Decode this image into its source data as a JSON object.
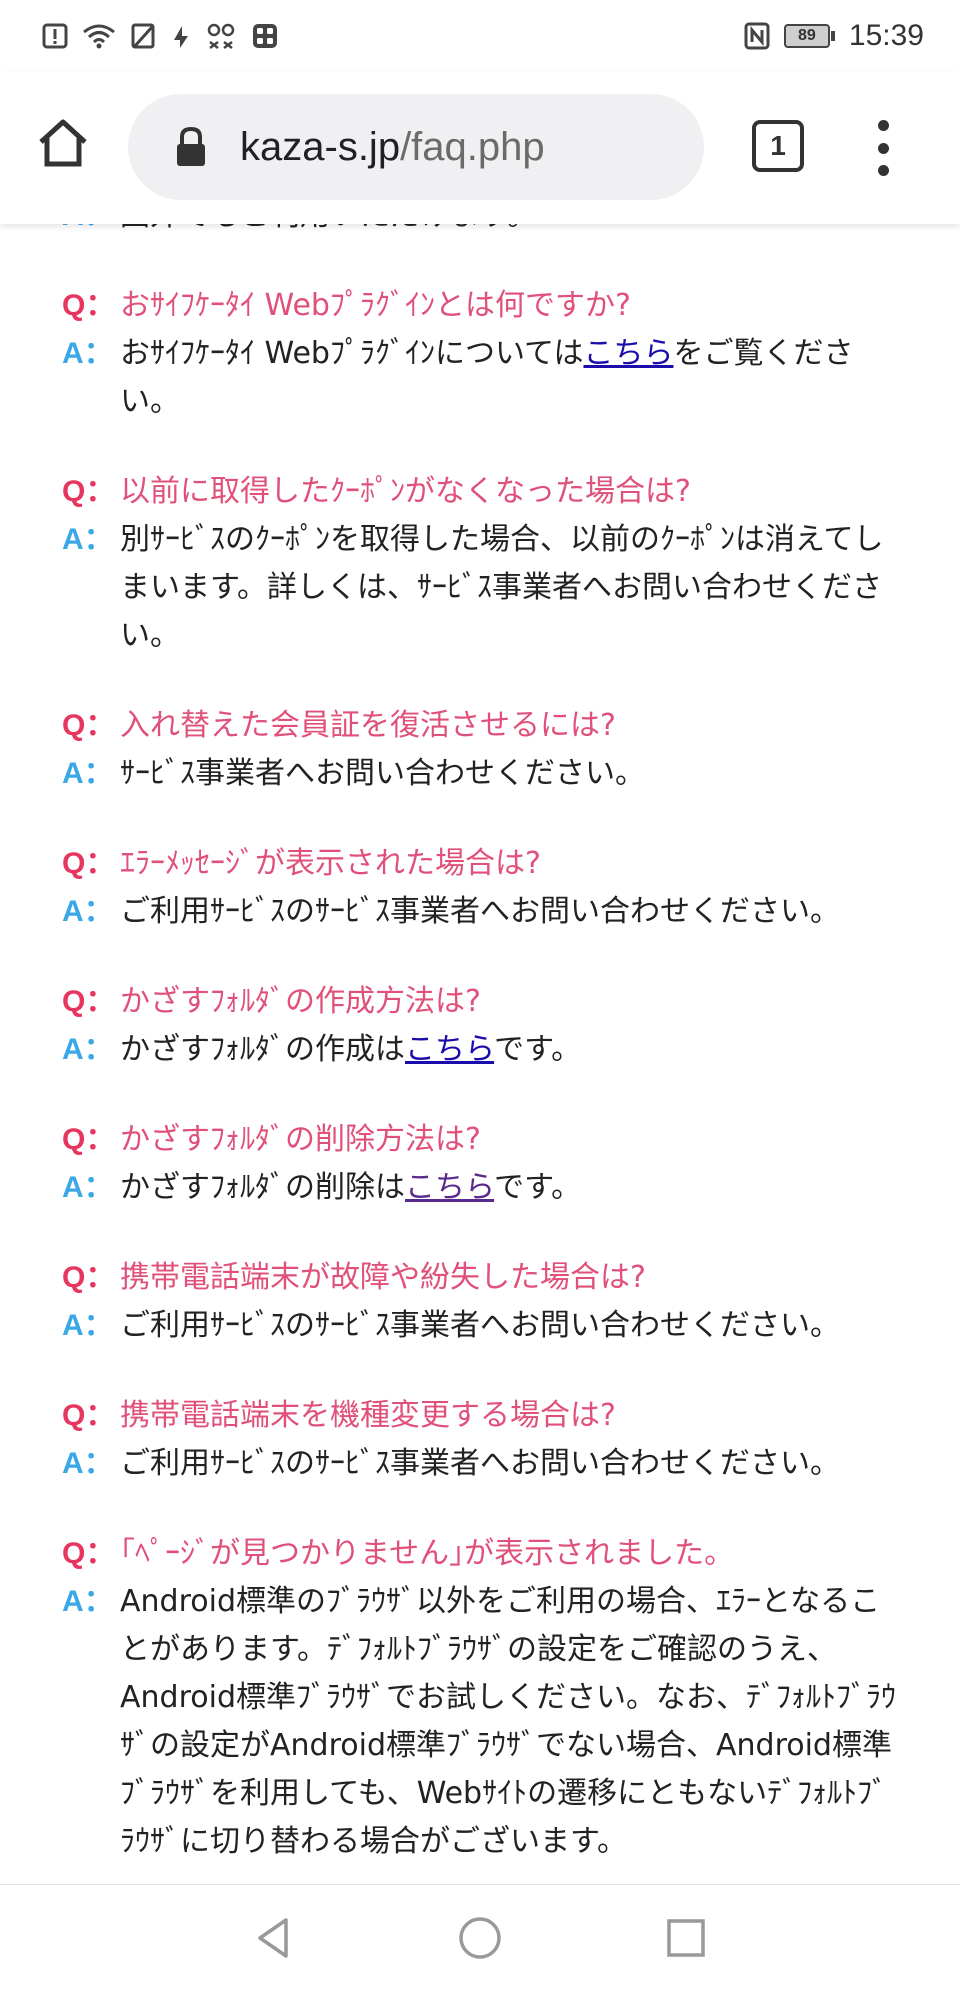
{
  "status_bar": {
    "time": "15:39",
    "battery": "89",
    "icons": [
      "alert-icon",
      "wifi-icon",
      "no-sim-icon",
      "data-icon",
      "notification-icon",
      "app-grid-icon",
      "nfc-icon"
    ]
  },
  "browser": {
    "url_domain": "kaza-s.jp",
    "url_path": "/faq.php",
    "tab_count": "1"
  },
  "faq": [
    {
      "q": "",
      "a": [
        "圏外でもご利用いただけます。"
      ]
    },
    {
      "q": "おｻｲﾌｹｰﾀｲ Webﾌﾟﾗｸﾞｲﾝとは何ですか?",
      "a": [
        "おｻｲﾌｹｰﾀｲ Webﾌﾟﾗｸﾞｲﾝについては",
        {
          "link": "こちら"
        },
        "をご覧ください。"
      ]
    },
    {
      "q": "以前に取得したｸｰﾎﾟﾝがなくなった場合は?",
      "a": [
        "別ｻｰﾋﾞｽのｸｰﾎﾟﾝを取得した場合、以前のｸｰﾎﾟﾝは消えてしまいます。詳しくは、ｻｰﾋﾞｽ事業者へお問い合わせください。"
      ]
    },
    {
      "q": "入れ替えた会員証を復活させるには?",
      "a": [
        "ｻｰﾋﾞｽ事業者へお問い合わせください。"
      ]
    },
    {
      "q": "ｴﾗｰﾒｯｾｰｼﾞが表示された場合は?",
      "a": [
        "ご利用ｻｰﾋﾞｽのｻｰﾋﾞｽ事業者へお問い合わせください。"
      ]
    },
    {
      "q": "かざすﾌｫﾙﾀﾞの作成方法は?",
      "a": [
        "かざすﾌｫﾙﾀﾞの作成は",
        {
          "link": "こちら"
        },
        "です。"
      ]
    },
    {
      "q": "かざすﾌｫﾙﾀﾞの削除方法は?",
      "a": [
        "かざすﾌｫﾙﾀﾞの削除は",
        {
          "link": "こちら",
          "visited": true
        },
        "です。"
      ]
    },
    {
      "q": "携帯電話端末が故障や紛失した場合は?",
      "a": [
        "ご利用ｻｰﾋﾞｽのｻｰﾋﾞｽ事業者へお問い合わせください。"
      ]
    },
    {
      "q": "携帯電話端末を機種変更する場合は?",
      "a": [
        "ご利用ｻｰﾋﾞｽのｻｰﾋﾞｽ事業者へお問い合わせください。"
      ]
    },
    {
      "q": "｢ﾍﾟｰｼﾞが見つかりません｣が表示されました。",
      "a": [
        "Android標準のﾌﾞﾗｳｻﾞ以外をご利用の場合、ｴﾗｰとなることがあります。ﾃﾞﾌｫﾙﾄﾌﾞﾗｳｻﾞの設定をご確認のうえ、Android標準ﾌﾞﾗｳｻﾞでお試しください。なお、ﾃﾞﾌｫﾙﾄﾌﾞﾗｳｻﾞの設定がAndroid標準ﾌﾞﾗｳｻﾞでない場合、Android標準ﾌﾞﾗｳｻﾞを利用しても、Webｻｲﾄの遷移にともないﾃﾞﾌｫﾙﾄﾌﾞﾗｳｻﾞに切り替わる場合がございます。"
      ]
    }
  ],
  "labels": {
    "q_mark": "Q：",
    "a_mark": "A："
  },
  "colors": {
    "question": "#e0507a",
    "q_mark": "#e6365f",
    "a_mark": "#3aa7e6",
    "link": "#1a0dab",
    "link_visited": "#5a2a8c"
  },
  "nav": {
    "buttons": [
      "back-icon",
      "home-circle-icon",
      "recents-icon"
    ]
  }
}
